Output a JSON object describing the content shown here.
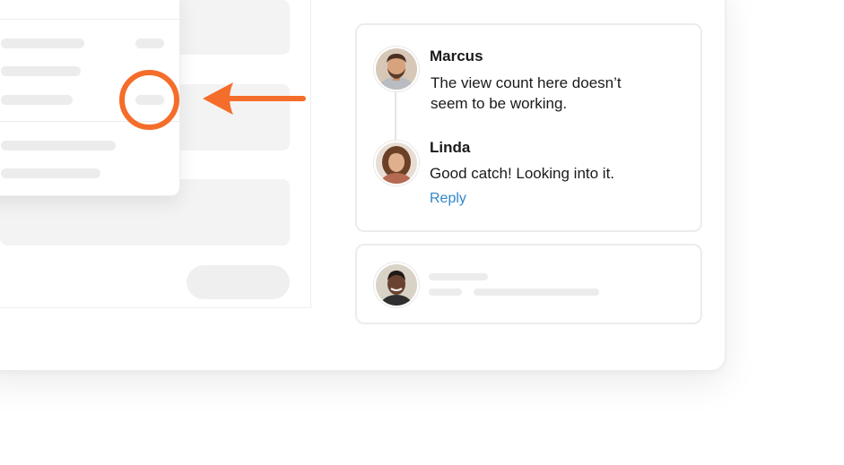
{
  "annotation": {
    "accent_color": "#f46d2a"
  },
  "comments": {
    "thread": [
      {
        "author": "Marcus",
        "text_line1": "The view count here doesn’t",
        "text_line2": "seem to be working."
      },
      {
        "author": "Linda",
        "text": "Good catch! Looking into it.",
        "reply_label": "Reply"
      }
    ],
    "link_color": "#2f87c8"
  },
  "icons": {
    "annotation_arrow": "arrow-left-icon",
    "highlight": "circle-outline-icon"
  }
}
